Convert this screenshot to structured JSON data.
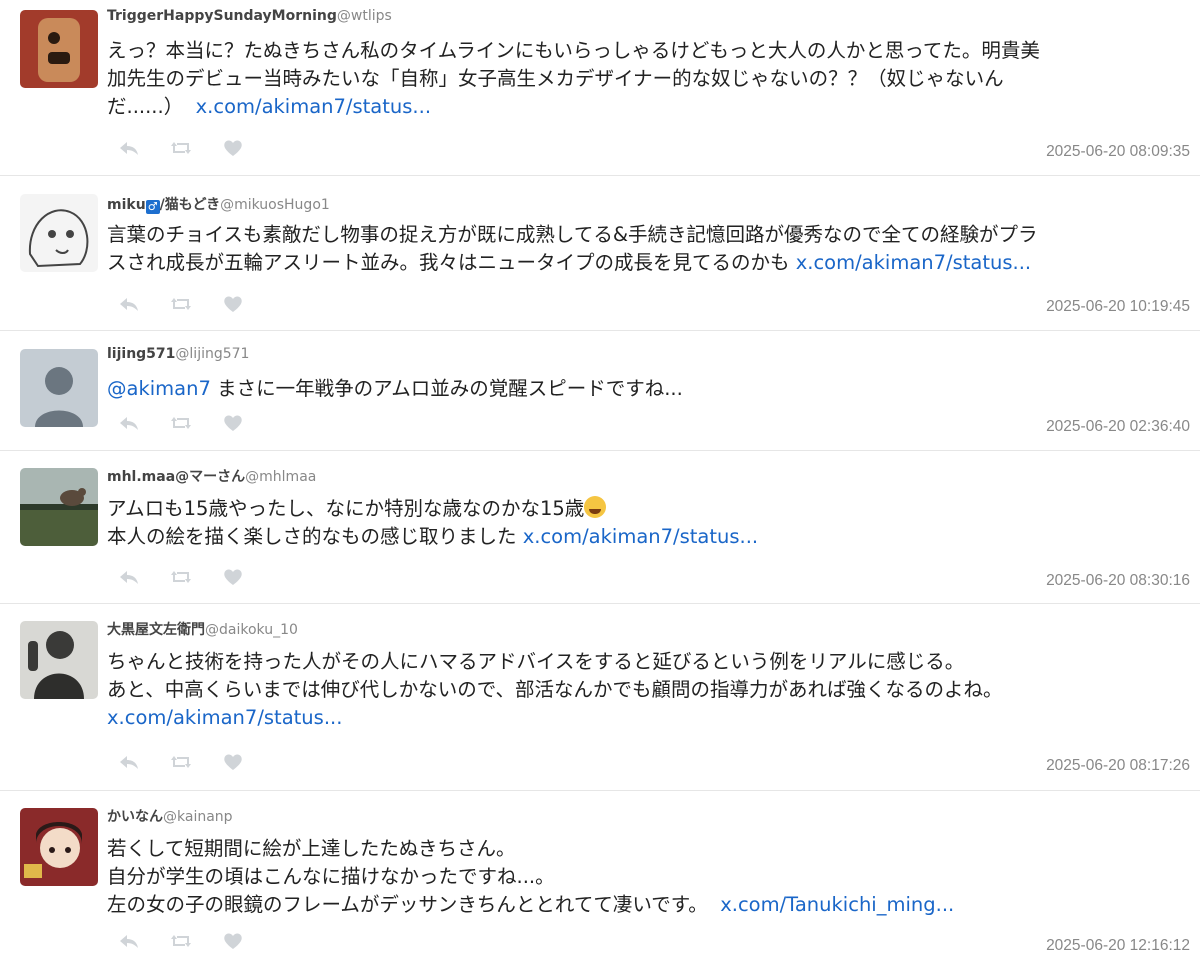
{
  "tweets": [
    {
      "name": "TriggerHappySundayMorning",
      "handle": "@wtlips",
      "lines": [
        "えっ？本当に？たぬきちさん私のタイムラインにもいらっしゃるけどもっと大人の人かと思ってた。明貴美",
        "加先生のデビュー当時みたいな「自称」女子高生メカデザイナー的な奴じゃないの？？（奴じゃないん",
        "だ......）"
      ],
      "link": "x.com/akiman7/status...",
      "timestamp": "2025-06-20 08:09:35"
    },
    {
      "name": "miku",
      "badge": "♂",
      "name_suffix": "/猫もどき",
      "handle": "@mikuosHugo1",
      "lines": [
        "言葉のチョイスも素敵だし物事の捉え方が既に成熟してる&手続き記憶回路が優秀なので全ての経験がプラ",
        "スされ成長が五輪アスリート並み。我々はニュータイプの成長を見てるのかも"
      ],
      "link": "x.com/akiman7/status...",
      "timestamp": "2025-06-20 10:19:45"
    },
    {
      "name": "lijing571",
      "handle": "@lijing571",
      "mention": "@akiman7",
      "lines": [
        " まさに一年戦争のアムロ並みの覚醒スピードですね..."
      ],
      "timestamp": "2025-06-20 02:36:40"
    },
    {
      "name": "mhl.maa@マーさん",
      "handle": "@mhlmaa",
      "lines": [
        "アムロも15歳やったし、なにか特別な歳なのかな15歳",
        "本人の絵を描く楽しさ的なもの感じ取りました"
      ],
      "emoji": "face-with-tears-of-joy",
      "link": "x.com/akiman7/status...",
      "timestamp": "2025-06-20 08:30:16"
    },
    {
      "name": "大黒屋文左衛門",
      "handle": "@daikoku_10",
      "lines": [
        "ちゃんと技術を持った人がその人にハマるアドバイスをすると延びるという例をリアルに感じる。",
        "あと、中高くらいまでは伸び代しかないので、部活なんかでも顧問の指導力があれば強くなるのよね。"
      ],
      "link": "x.com/akiman7/status...",
      "timestamp": "2025-06-20 08:17:26"
    },
    {
      "name": "かいなん",
      "handle": "@kainanp",
      "lines": [
        "若くして短期間に絵が上達したたぬきちさん。",
        "自分が学生の頃はこんなに描けなかったですね...。",
        "左の女の子の眼鏡のフレームがデッサンきちんととれてて凄いです。"
      ],
      "link": "x.com/Tanukichi_ming...",
      "timestamp": "2025-06-20 12:16:12"
    }
  ],
  "icons": {
    "reply": "reply-icon",
    "retweet": "retweet-icon",
    "like": "heart-icon"
  },
  "colors": {
    "link": "#1a66c8",
    "timestamp": "#888888",
    "action_icon": "#d0d4d8"
  }
}
